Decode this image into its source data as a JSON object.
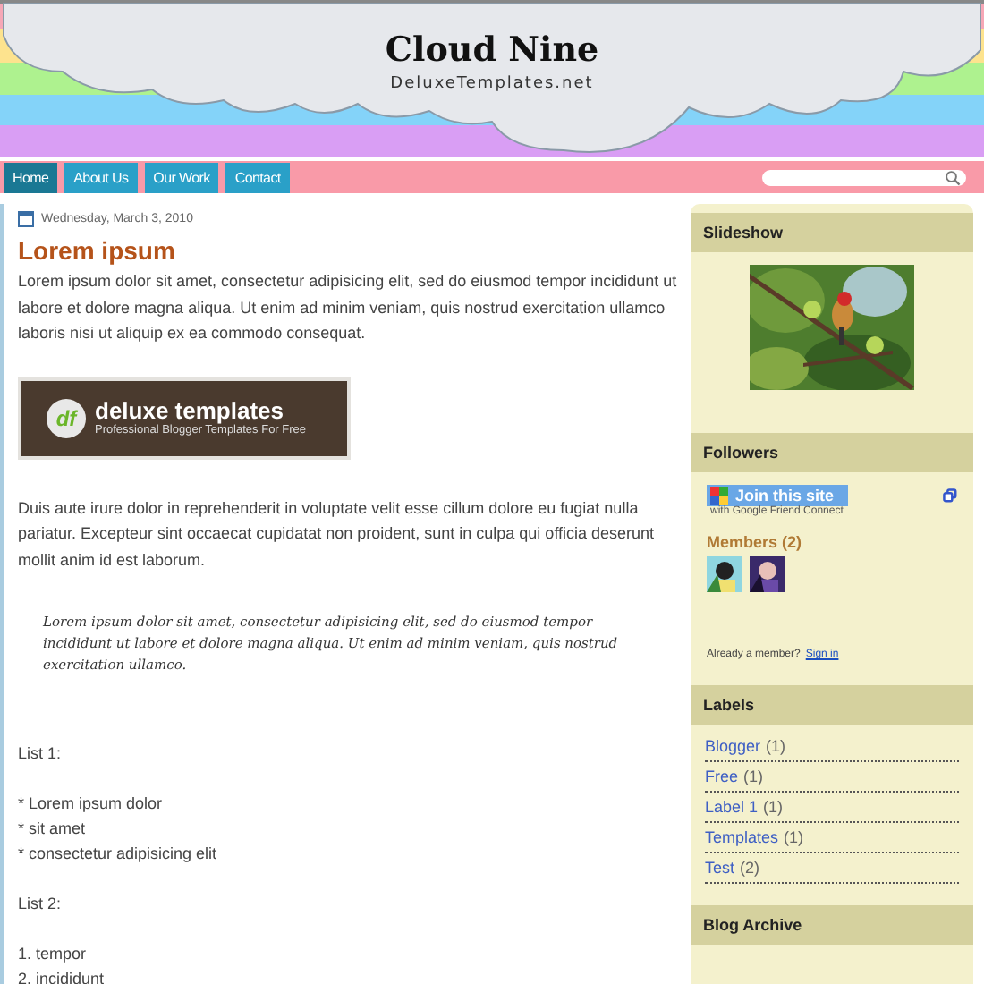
{
  "header": {
    "title": "Cloud Nine",
    "subtitle": "DeluxeTemplates.net"
  },
  "nav": [
    {
      "label": "Home",
      "selected": true
    },
    {
      "label": "About Us",
      "selected": false
    },
    {
      "label": "Our Work",
      "selected": false
    },
    {
      "label": "Contact",
      "selected": false
    }
  ],
  "post": {
    "date": "Wednesday, March 3, 2010",
    "title": "Lorem ipsum",
    "intro": "Lorem ipsum dolor sit amet, consectetur adipisicing elit, sed do eiusmod tempor incididunt ut labore et dolore magna aliqua. Ut enim ad minim veniam, quis nostrud exercitation ullamco laboris nisi ut aliquip ex ea commodo consequat.",
    "banner": {
      "logo": "df",
      "title": "deluxe templates",
      "tagline": "Professional Blogger Templates For Free"
    },
    "body": "Duis aute irure dolor in reprehenderit in voluptate velit esse cillum dolore eu fugiat nulla pariatur. Excepteur sint occaecat cupidatat non proident, sunt in culpa qui officia deserunt mollit anim id est laborum.",
    "quote": "Lorem ipsum dolor sit amet, consectetur adipisicing elit, sed do eiusmod tempor incididunt ut labore et dolore magna aliqua. Ut enim ad minim veniam, quis nostrud exercitation ullamco.",
    "list1_heading": "List 1:",
    "list1": [
      "* Lorem ipsum dolor",
      "* sit amet",
      "* consectetur adipisicing elit"
    ],
    "list2_heading": "List 2:",
    "list2": [
      "1. tempor",
      "2. incididunt"
    ]
  },
  "sidebar": {
    "slideshow": {
      "title": "Slideshow"
    },
    "followers": {
      "title": "Followers",
      "join_button": "Join this site",
      "join_caption": "with Google Friend Connect",
      "members_label": "Members (2)",
      "already_member": "Already a member?",
      "sign_in": "Sign in"
    },
    "labels": {
      "title": "Labels",
      "items": [
        {
          "name": "Blogger",
          "count": "(1)"
        },
        {
          "name": "Free",
          "count": "(1)"
        },
        {
          "name": "Label 1",
          "count": "(1)"
        },
        {
          "name": "Templates",
          "count": "(1)"
        },
        {
          "name": "Test",
          "count": "(2)"
        }
      ]
    },
    "archive": {
      "title": "Blog Archive"
    }
  }
}
